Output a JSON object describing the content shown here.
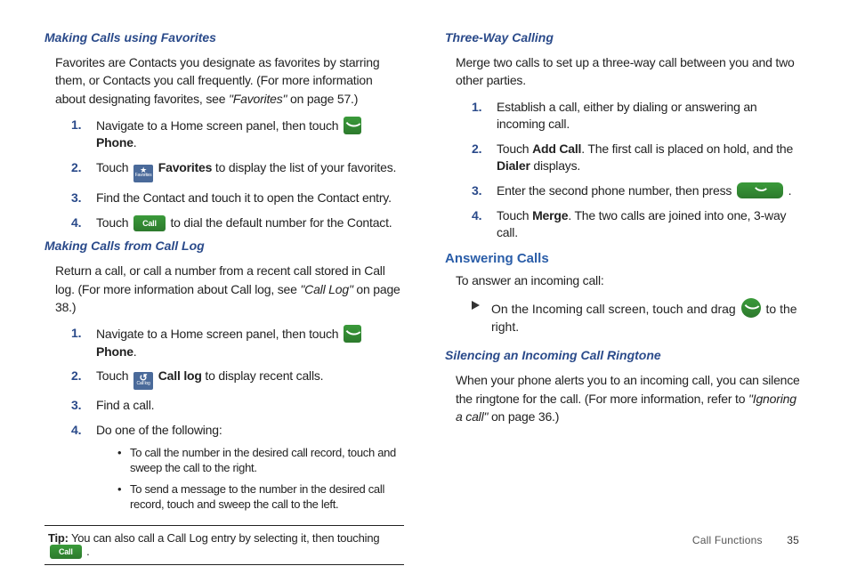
{
  "left": {
    "h1": "Making Calls using Favorites",
    "p1a": "Favorites are Contacts you designate as favorites by starring them, or Contacts you call frequently. (For more information about designating favorites, see ",
    "p1b": "\"Favorites\"",
    "p1c": " on page 57.)",
    "li1a": "Navigate to a Home screen panel, then touch ",
    "li1b": "Phone",
    "li1c": ".",
    "li2a": "Touch ",
    "li2b": "Favorites",
    "li2c": " to display the list of your favorites.",
    "li3": "Find the Contact and touch it to open the Contact entry.",
    "li4a": "Touch ",
    "li4b": " to dial the default number for the Contact.",
    "callLabel": "Call",
    "favIconLabel": "Favorites",
    "h2": "Making Calls from Call Log",
    "p2a": "Return a call, or call a number from a recent call stored in Call log. (For more information about Call log, see ",
    "p2b": "\"Call Log\"",
    "p2c": " on page 38.)",
    "cl1a": "Navigate to a Home screen panel, then touch ",
    "cl1b": "Phone",
    "cl1c": ".",
    "cl2a": "Touch ",
    "cl2b": "Call log",
    "cl2c": " to display recent calls.",
    "logIconLabel": "Call log",
    "cl3": "Find a call.",
    "cl4": "Do one of the following:",
    "ul1": "To call the number in the desired call record, touch and sweep the call to the right.",
    "ul2": "To send a message to the number in the desired call record, touch and sweep the call to the left.",
    "tipLabel": "Tip:",
    "tipText": " You can also call a Call Log entry by selecting it, then touching ",
    "tipEnd": " ."
  },
  "right": {
    "h1": "Three-Way Calling",
    "p1": "Merge two calls to set up a three-way call between you and two other parties.",
    "li1": "Establish a call, either by dialing or answering an incoming call.",
    "li2a": "Touch ",
    "li2b": "Add Call",
    "li2c": ". The first call is placed on hold, and the ",
    "li2d": "Dialer",
    "li2e": " displays.",
    "li3a": "Enter the second phone number, then press ",
    "li3b": " .",
    "li4a": "Touch ",
    "li4b": "Merge",
    "li4c": ". The two calls are joined into one, 3-way call.",
    "h2": "Answering Calls",
    "p2": "To answer an incoming call:",
    "arrow1a": "On the Incoming call screen, touch and drag ",
    "arrow1b": " to the right.",
    "h3": "Silencing an Incoming Call Ringtone",
    "p3a": "When your phone alerts you to an incoming call, you can silence the ringtone for the call. (For more information, refer to ",
    "p3b": "\"Ignoring a call\"",
    "p3c": " on page 36.)"
  },
  "footer": {
    "section": "Call Functions",
    "page": "35"
  }
}
